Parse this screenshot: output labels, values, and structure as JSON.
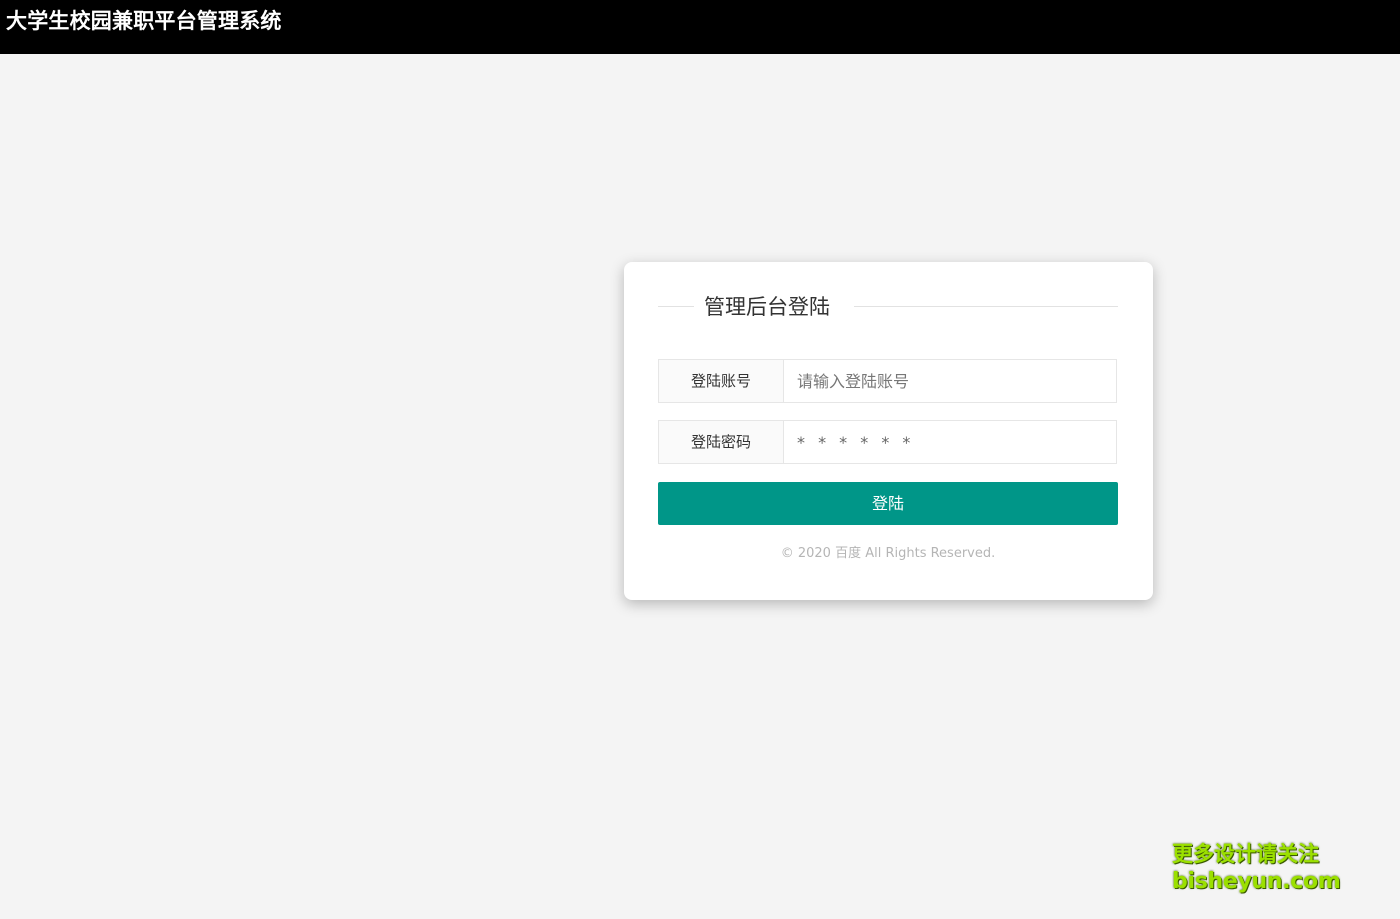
{
  "header": {
    "title": "大学生校园兼职平台管理系统"
  },
  "login": {
    "legend": "管理后台登陆",
    "account_label": "登陆账号",
    "account_placeholder": "请输入登陆账号",
    "password_label": "登陆密码",
    "password_placeholder": "* * * * * *",
    "submit_label": "登陆",
    "copyright": "© 2020 百度 All Rights Reserved."
  },
  "watermark": {
    "line1": "更多设计请关注",
    "line2": "bisheyun.com"
  },
  "colors": {
    "header_bg": "#000000",
    "page_bg": "#f4f4f4",
    "button_bg": "#009688",
    "watermark": "#9be000"
  }
}
